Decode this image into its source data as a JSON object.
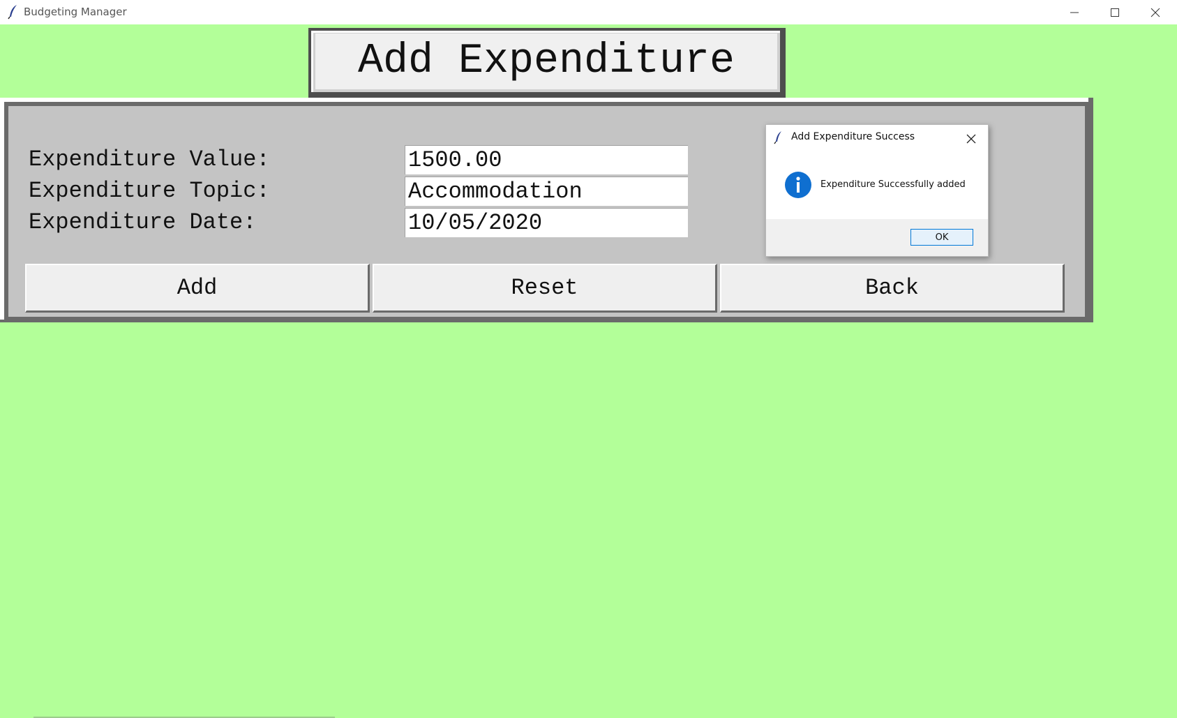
{
  "window": {
    "title": "Budgeting Manager",
    "icon": "feather-icon",
    "controls": [
      "minimize-icon",
      "maximize-icon",
      "close-icon"
    ]
  },
  "header": {
    "title": "Add Expenditure"
  },
  "form": {
    "fields": [
      {
        "label": "Expenditure Value:",
        "value": "1500.00"
      },
      {
        "label": "Expenditure Topic:",
        "value": "Accommodation"
      },
      {
        "label": "Expenditure Date:",
        "value": "10/05/2020"
      }
    ]
  },
  "buttons": {
    "add": "Add",
    "reset": "Reset",
    "back": "Back"
  },
  "dialog": {
    "title": "Add Expenditure Success",
    "message": "Expenditure Successfully added",
    "ok_label": "OK",
    "icon": "info-icon"
  },
  "colors": {
    "background": "#b3ff99",
    "panel": "#c4c4c4",
    "info_blue": "#0f6fd0"
  }
}
